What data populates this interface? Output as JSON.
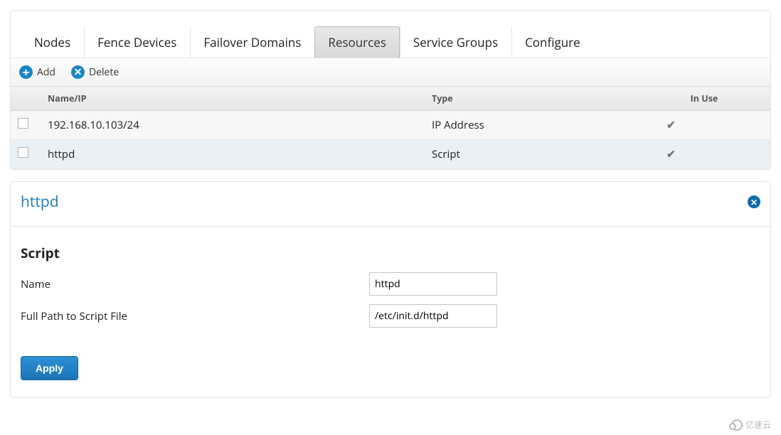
{
  "tabs": {
    "items": [
      {
        "label": "Nodes"
      },
      {
        "label": "Fence Devices"
      },
      {
        "label": "Failover Domains"
      },
      {
        "label": "Resources"
      },
      {
        "label": "Service Groups"
      },
      {
        "label": "Configure"
      }
    ],
    "active_index": 3
  },
  "toolbar": {
    "add_label": "Add",
    "delete_label": "Delete"
  },
  "table": {
    "headers": {
      "name_ip": "Name/IP",
      "type": "Type",
      "in_use": "In Use"
    },
    "rows": [
      {
        "name": "192.168.10.103/24",
        "type": "IP Address",
        "in_use": true
      },
      {
        "name": "httpd",
        "type": "Script",
        "in_use": true
      }
    ]
  },
  "detail": {
    "title": "httpd",
    "section": "Script",
    "fields": {
      "name_label": "Name",
      "name_value": "httpd",
      "path_label": "Full Path to Script File",
      "path_value": "/etc/init.d/httpd"
    },
    "apply_label": "Apply"
  },
  "watermark": "亿速云"
}
